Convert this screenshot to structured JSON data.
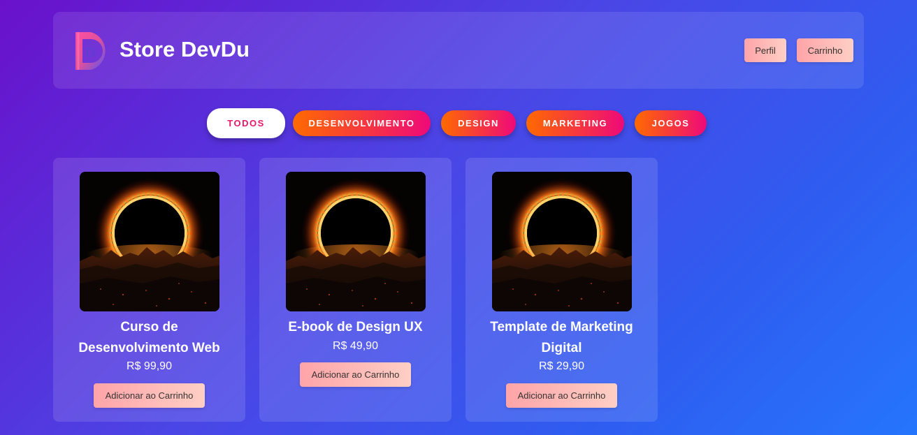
{
  "header": {
    "brand": "Store DevDu",
    "logo_letter": "D",
    "buttons": {
      "profile": "Perfil",
      "cart": "Carrinho"
    }
  },
  "filters": [
    {
      "label": "TODOS",
      "active": true
    },
    {
      "label": "DESENVOLVIMENTO",
      "active": false
    },
    {
      "label": "DESIGN",
      "active": false
    },
    {
      "label": "MARKETING",
      "active": false
    },
    {
      "label": "JOGOS",
      "active": false
    }
  ],
  "products": [
    {
      "title": "Curso de Desenvolvimento Web",
      "price": "R$ 99,90",
      "button": "Adicionar ao Carrinho",
      "image": "solar-eclipse-image"
    },
    {
      "title": "E-book de Design UX",
      "price": "R$ 49,90",
      "button": "Adicionar ao Carrinho",
      "image": "solar-eclipse-image"
    },
    {
      "title": "Template de Marketing Digital",
      "price": "R$ 29,90",
      "button": "Adicionar ao Carrinho",
      "image": "solar-eclipse-image"
    }
  ],
  "colors": {
    "background_from": "#6a11cb",
    "background_to": "#2575fc",
    "filter_from": "#ff6a00",
    "filter_to": "#ee0979",
    "active_filter_text": "#e6186b",
    "button_from": "#ffa4a8",
    "button_to": "#ffcfc4"
  }
}
